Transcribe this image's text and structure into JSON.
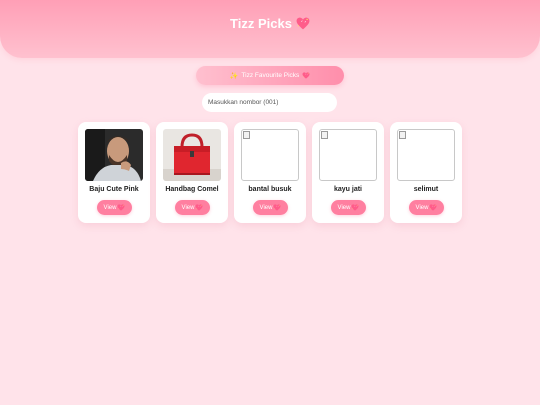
{
  "header": {
    "title": "Tizz Picks",
    "title_icon": "sparkling-heart-icon"
  },
  "favourites": {
    "label": "Tizz Favourite Picks",
    "leading_icon": "sparkle-icon",
    "trailing_icon": "sparkling-heart-icon"
  },
  "search": {
    "placeholder": "Masukkan nombor (001)",
    "value": ""
  },
  "products": [
    {
      "name": "Baju Cute Pink",
      "image": "man-portrait-photo",
      "button_label": "View"
    },
    {
      "name": "Handbag Comel",
      "image": "red-handbag-photo",
      "button_label": "View"
    },
    {
      "name": "bantal busuk",
      "image": "broken-image",
      "button_label": "View"
    },
    {
      "name": "kayu jati",
      "image": "broken-image",
      "button_label": "View"
    },
    {
      "name": "selimut",
      "image": "broken-image",
      "button_label": "View"
    }
  ],
  "colors": {
    "accent": "#ff7fa0",
    "background": "#ffe3ea",
    "header_top": "#ff9fb6"
  }
}
